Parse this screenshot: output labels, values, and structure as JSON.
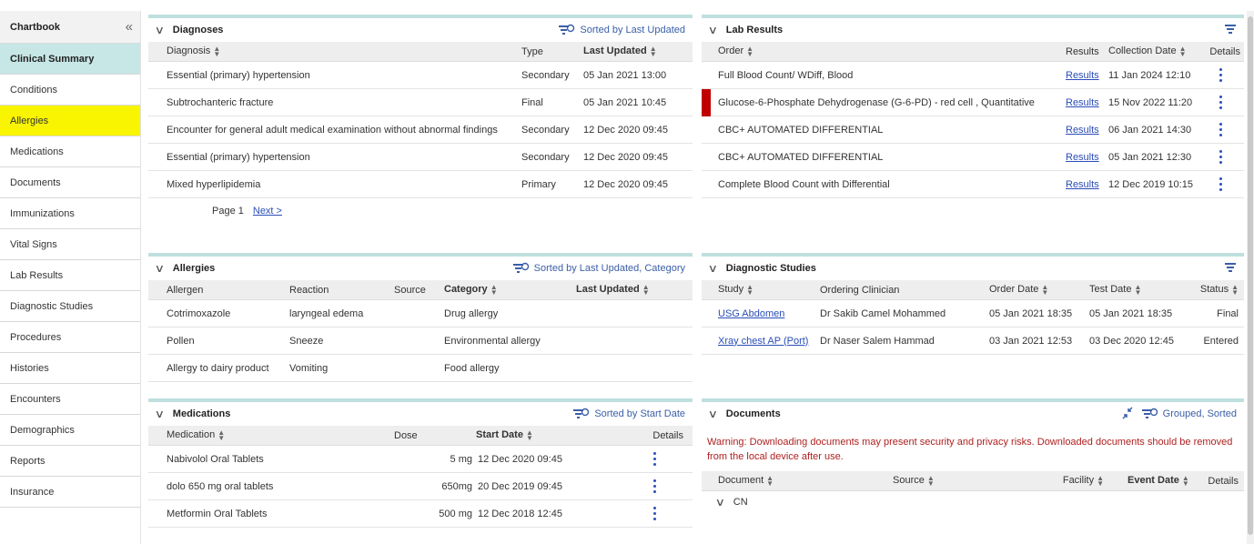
{
  "sidebar": {
    "title": "Chartbook",
    "items": [
      {
        "label": "Clinical Summary",
        "state": "active"
      },
      {
        "label": "Conditions",
        "state": ""
      },
      {
        "label": "Allergies",
        "state": "highlight"
      },
      {
        "label": "Medications",
        "state": ""
      },
      {
        "label": "Documents",
        "state": ""
      },
      {
        "label": "Immunizations",
        "state": ""
      },
      {
        "label": "Vital Signs",
        "state": ""
      },
      {
        "label": "Lab Results",
        "state": ""
      },
      {
        "label": "Diagnostic Studies",
        "state": ""
      },
      {
        "label": "Procedures",
        "state": ""
      },
      {
        "label": "Histories",
        "state": ""
      },
      {
        "label": "Encounters",
        "state": ""
      },
      {
        "label": "Demographics",
        "state": ""
      },
      {
        "label": "Reports",
        "state": ""
      },
      {
        "label": "Insurance",
        "state": ""
      }
    ]
  },
  "diagnoses": {
    "title": "Diagnoses",
    "sort_label": "Sorted by Last Updated",
    "headers": {
      "diagnosis": "Diagnosis",
      "type": "Type",
      "last_updated": "Last Updated"
    },
    "rows": [
      {
        "diagnosis": "Essential (primary) hypertension",
        "type": "Secondary",
        "last_updated": "05 Jan 2021 13:00"
      },
      {
        "diagnosis": "Subtrochanteric fracture",
        "type": "Final",
        "last_updated": "05 Jan 2021 10:45"
      },
      {
        "diagnosis": "Encounter for general adult medical examination without abnormal findings",
        "type": "Secondary",
        "last_updated": "12 Dec 2020 09:45"
      },
      {
        "diagnosis": "Essential (primary) hypertension",
        "type": "Secondary",
        "last_updated": "12 Dec 2020 09:45"
      },
      {
        "diagnosis": "Mixed hyperlipidemia",
        "type": "Primary",
        "last_updated": "12 Dec 2020 09:45"
      }
    ],
    "page_label": "Page 1",
    "next_label": "Next >"
  },
  "allergies": {
    "title": "Allergies",
    "sort_label": "Sorted by Last Updated, Category",
    "headers": {
      "allergen": "Allergen",
      "reaction": "Reaction",
      "source": "Source",
      "category": "Category",
      "last_updated": "Last Updated"
    },
    "rows": [
      {
        "allergen": "Cotrimoxazole",
        "reaction": "laryngeal edema",
        "category": "Drug allergy"
      },
      {
        "allergen": "Pollen",
        "reaction": "Sneeze",
        "category": "Environmental allergy"
      },
      {
        "allergen": "Allergy to dairy product",
        "reaction": "Vomiting",
        "category": "Food allergy"
      }
    ]
  },
  "medications": {
    "title": "Medications",
    "sort_label": "Sorted by Start Date",
    "headers": {
      "medication": "Medication",
      "dose": "Dose",
      "start_date": "Start Date",
      "details": "Details"
    },
    "rows": [
      {
        "medication": "Nabivolol Oral Tablets",
        "dose": "5 mg",
        "start_date": "12 Dec 2020 09:45"
      },
      {
        "medication": "dolo 650 mg oral tablets",
        "dose": "650mg",
        "start_date": "20 Dec 2019 09:45"
      },
      {
        "medication": "Metformin Oral Tablets",
        "dose": "500 mg",
        "start_date": "12 Dec 2018 12:45"
      }
    ]
  },
  "lab_results": {
    "title": "Lab Results",
    "headers": {
      "order": "Order",
      "results": "Results",
      "collection_date": "Collection Date",
      "details": "Details"
    },
    "rows": [
      {
        "order": "Full Blood Count/ WDiff, Blood",
        "results": "Results",
        "collection_date": "11 Jan 2024 12:10",
        "flag": false
      },
      {
        "order": "Glucose-6-Phosphate Dehydrogenase (G-6-PD) - red cell , Quantitative",
        "results": "Results",
        "collection_date": "15 Nov 2022 11:20",
        "flag": true
      },
      {
        "order": "CBC+ AUTOMATED DIFFERENTIAL",
        "results": "Results",
        "collection_date": "06 Jan 2021 14:30",
        "flag": false
      },
      {
        "order": "CBC+ AUTOMATED DIFFERENTIAL",
        "results": "Results",
        "collection_date": "05 Jan 2021 12:30",
        "flag": false
      },
      {
        "order": "Complete Blood Count with Differential",
        "results": "Results",
        "collection_date": "12 Dec 2019 10:15",
        "flag": false
      }
    ]
  },
  "diagnostic_studies": {
    "title": "Diagnostic Studies",
    "headers": {
      "study": "Study",
      "clinician": "Ordering Clinician",
      "order_date": "Order Date",
      "test_date": "Test Date",
      "status": "Status"
    },
    "rows": [
      {
        "study": "USG Abdomen",
        "clinician": "Dr Sakib Camel Mohammed",
        "order_date": "05 Jan 2021 18:35",
        "test_date": "05 Jan 2021 18:35",
        "status": "Final"
      },
      {
        "study": "Xray chest AP (Port)",
        "clinician": "Dr Naser Salem Hammad",
        "order_date": "03 Jan 2021 12:53",
        "test_date": "03 Dec 2020 12:45",
        "status": "Entered"
      }
    ]
  },
  "documents": {
    "title": "Documents",
    "sort_label": "Grouped, Sorted",
    "warning": "Warning: Downloading documents may present security and privacy risks. Downloaded documents should be removed from the local device after use.",
    "headers": {
      "document": "Document",
      "source": "Source",
      "facility": "Facility",
      "event_date": "Event Date",
      "details": "Details"
    },
    "group": "CN"
  },
  "colors": {
    "accent": "#bfe0df",
    "active_bg": "#c7e6e6",
    "highlight": "#f9f400",
    "link": "#2a4db8",
    "warning": "#b02020",
    "flag": "#c00000"
  }
}
